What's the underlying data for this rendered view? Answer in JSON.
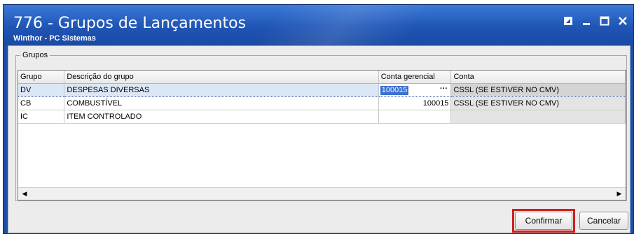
{
  "window": {
    "title": "776 - Grupos de Lançamentos",
    "subtitle": "Winthor - PC Sistemas"
  },
  "groupbox": {
    "label": "Grupos"
  },
  "table": {
    "columns": [
      "Grupo",
      "Descrição do grupo",
      "Conta gerencial",
      "Conta"
    ],
    "rows": [
      {
        "grupo": "DV",
        "descricao": "DESPESAS DIVERSAS",
        "conta_gerencial": "100015",
        "conta": "CSSL (SE ESTIVER NO CMV)",
        "selected": true
      },
      {
        "grupo": "CB",
        "descricao": "COMBUSTÍVEL",
        "conta_gerencial": "100015",
        "conta": "CSSL (SE ESTIVER NO CMV)",
        "selected": false
      },
      {
        "grupo": "IC",
        "descricao": "ITEM CONTROLADO",
        "conta_gerencial": "",
        "conta": "",
        "selected": false
      }
    ]
  },
  "buttons": {
    "confirm": "Confirmar",
    "cancel": "Cancelar"
  },
  "icons": {
    "restore": "restore-icon",
    "minimize": "minimize-icon",
    "maximize": "maximize-icon",
    "close": "close-icon"
  },
  "colors": {
    "titlebar": "#1f55b5",
    "selection": "#3b6fd0",
    "highlight_border": "#d01f1f"
  }
}
